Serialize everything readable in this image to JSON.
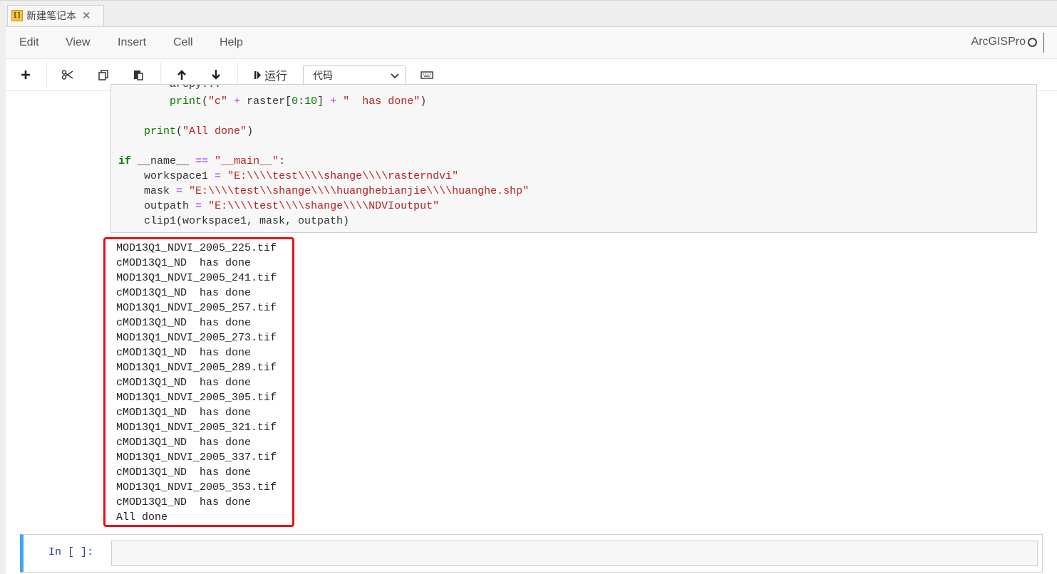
{
  "tab": {
    "title": "新建笔记本",
    "icon_text": "[]"
  },
  "menu": {
    "items": [
      "Edit",
      "View",
      "Insert",
      "Cell",
      "Help"
    ],
    "kernel_name": "ArcGISPro"
  },
  "toolbar": {
    "run_label": "运行",
    "cell_type": "代码",
    "buttons": [
      "add-cell",
      "cut",
      "copy",
      "paste",
      "move-up",
      "move-down",
      "run",
      "keyboard"
    ]
  },
  "code_cell": {
    "lines": [
      "            print(\"c\" + raster[0:10] + \"  has done\")",
      "",
      "        print(\"All done\")",
      "",
      "    if __name__ == \"__main__\":",
      "        workspace1 = \"E:\\\\test\\\\shange\\\\rasterndvi\"",
      "        mask = \"E:\\\\test\\\\shange\\\\huanghebianjie\\\\huanghe.shp\"",
      "        outpath = \"E:\\\\test\\\\shange\\\\NDVIoutput\"",
      "        clip1(workspace1, mask, outpath)"
    ]
  },
  "output": {
    "lines": [
      "MOD13Q1_NDVI_2005_225.tif",
      "cMOD13Q1_ND  has done",
      "MOD13Q1_NDVI_2005_241.tif",
      "cMOD13Q1_ND  has done",
      "MOD13Q1_NDVI_2005_257.tif",
      "cMOD13Q1_ND  has done",
      "MOD13Q1_NDVI_2005_273.tif",
      "cMOD13Q1_ND  has done",
      "MOD13Q1_NDVI_2005_289.tif",
      "cMOD13Q1_ND  has done",
      "MOD13Q1_NDVI_2005_305.tif",
      "cMOD13Q1_ND  has done",
      "MOD13Q1_NDVI_2005_321.tif",
      "cMOD13Q1_ND  has done",
      "MOD13Q1_NDVI_2005_337.tif",
      "cMOD13Q1_ND  has done",
      "MOD13Q1_NDVI_2005_353.tif",
      "cMOD13Q1_ND  has done",
      "All done"
    ],
    "highlight_color": "#e8121b"
  },
  "empty_cell": {
    "prompt": "In [ ]:"
  },
  "colors": {
    "selected_cell_border": "#42a5f5",
    "prompt": "#303f9f"
  }
}
